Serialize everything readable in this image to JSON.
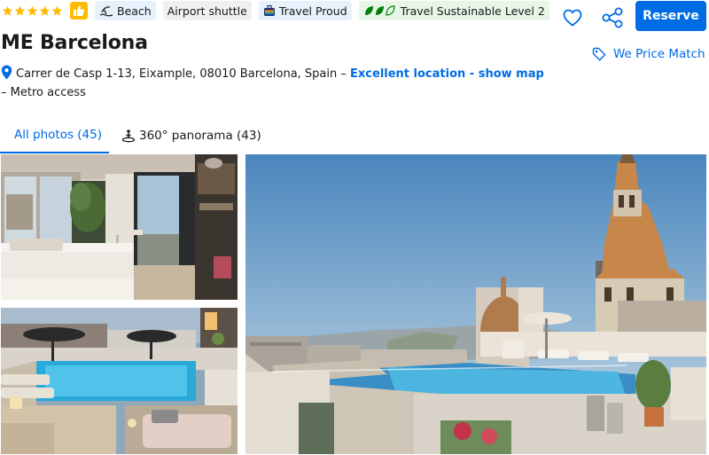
{
  "rating": {
    "stars": 5
  },
  "badges": {
    "beach": "Beach",
    "airport": "Airport shuttle",
    "travel_proud": "Travel Proud",
    "sustainable": "Travel Sustainable Level 2"
  },
  "actions": {
    "reserve": "Reserve",
    "price_match": "We Price Match"
  },
  "hotel": {
    "name": "ME Barcelona",
    "address": "Carrer de Casp 1-13, Eixample, 08010 Barcelona, Spain",
    "sep1": " – ",
    "location_link": "Excellent location - show map",
    "sep2": " – ",
    "extra": "Metro access"
  },
  "tabs": {
    "all_photos": "All photos (45)",
    "panorama": "360° panorama (43)"
  },
  "colors": {
    "accent": "#006ce4",
    "star": "#febb02",
    "sustainable": "#008009"
  },
  "photos": [
    {
      "name": "hotel-room-photo"
    },
    {
      "name": "indoor-pool-photo"
    },
    {
      "name": "rooftop-pool-photo"
    }
  ]
}
